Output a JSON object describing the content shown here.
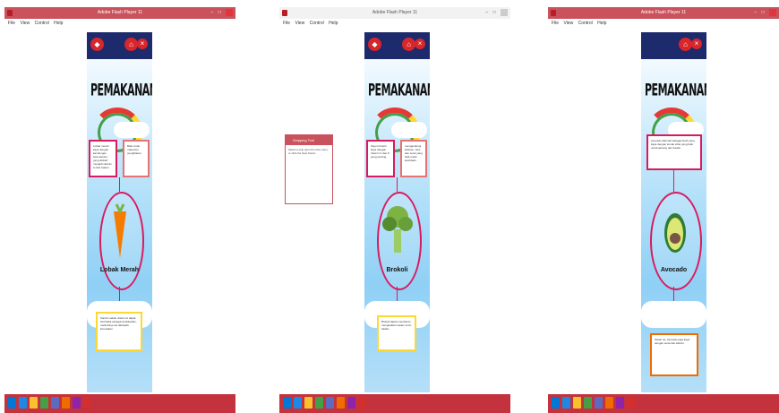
{
  "window": {
    "title": "Adobe Flash Player 11"
  },
  "menu": [
    "File",
    "View",
    "Control",
    "Help"
  ],
  "app_title": "PEMAKANAN",
  "panels": [
    {
      "food": "Lobak Merah",
      "card_left": "Lobak merah kaya dengan kandungan beta-karotin, yang diubah menjadi vitamin A oleh badan.",
      "card_right": "Baik untuk mata dan penglihatan.",
      "card_bottom": "Karotin selain vitamin A dapat bertindak sebagai antioksidan, melindungi sel daripada kerosakan."
    },
    {
      "food": "Brokoli",
      "card_left": "Sayur brokoli kaya dengan vitamin C dan K yang penting.",
      "card_right": "mengandungi kalsium, besi dan serat yang baik untuk kesihatan.",
      "card_bottom": "Brokoli dapat membantu menguatkan sistem imun badan."
    },
    {
      "food": "Avocado",
      "card_top": "Avocado dikenali sebagai buah yang kaya dengan lemak sihat yang baik untuk jantung dan badan.",
      "card_bottom": "Selain itu, Avocado juga kaya dengan serat dan kalium."
    }
  ],
  "snipping": {
    "title": "Snipping Tool",
    "body": "Select a snip type from the menu, or click the New button."
  },
  "colors": {
    "titlebar": "#c9525c",
    "taskbar": "#c3323d",
    "card_border": "#d81b60"
  }
}
